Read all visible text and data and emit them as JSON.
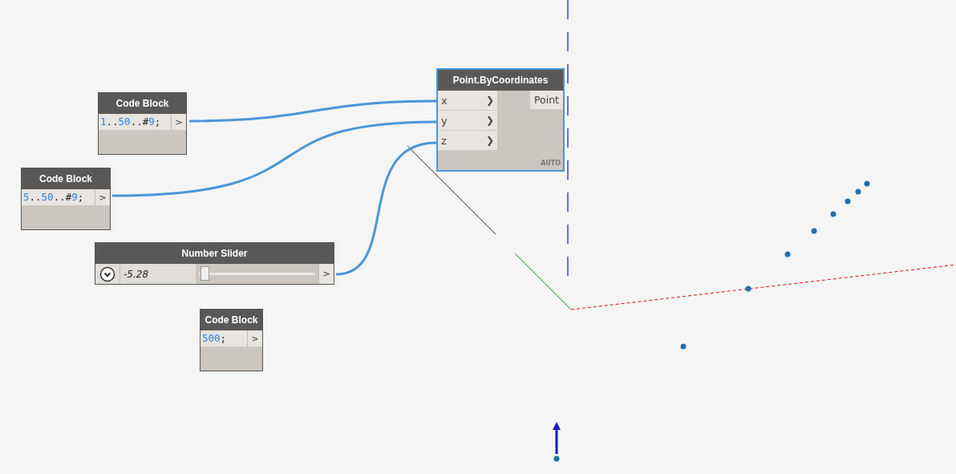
{
  "nodes": [
    {
      "kind": "code",
      "title": "Code Block",
      "code": "1..50..#9;",
      "output": ">",
      "selected": false
    },
    {
      "kind": "code",
      "title": "Code Block",
      "code": "5..50..#9;",
      "output": ">",
      "selected": false
    },
    {
      "kind": "slider",
      "title": "Number Slider",
      "value": "-5.28",
      "level": 0.03,
      "output": ">",
      "selected": false
    },
    {
      "kind": "code",
      "title": "Code Block",
      "code": "500;",
      "output": ">",
      "selected": false
    },
    {
      "kind": "function",
      "title": "Point.ByCoordinates",
      "inputs": [
        "x",
        "y",
        "z"
      ],
      "input_arrow": "❯",
      "output": "Point",
      "lacing": "AUTO",
      "selected": true
    }
  ]
}
